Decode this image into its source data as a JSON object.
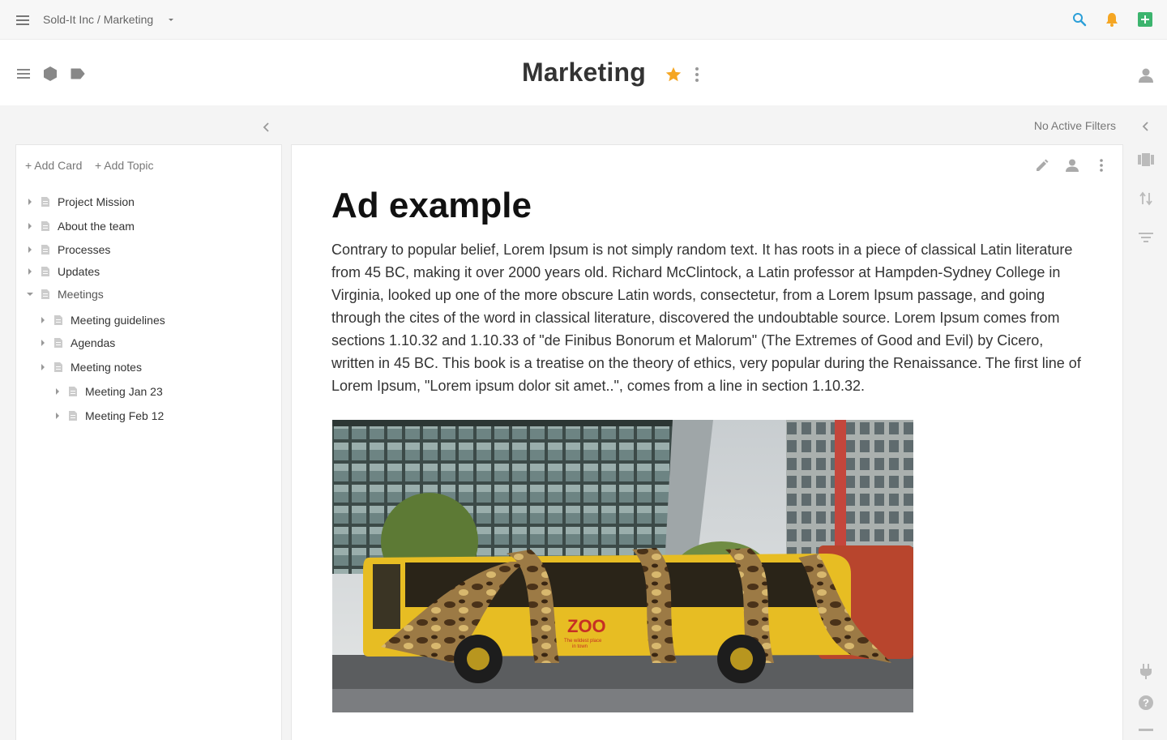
{
  "topbar": {
    "breadcrumb": "Sold-It Inc / Marketing",
    "colors": {
      "search": "#2b9fd8",
      "bell": "#f5a623",
      "add": "#3cb46e"
    },
    "icons": [
      "menu-icon",
      "chevron-down-icon",
      "search-icon",
      "bell-icon",
      "add-square-icon"
    ]
  },
  "header": {
    "title": "Marketing",
    "star_color": "#f5a623",
    "icons": [
      "list-icon",
      "hexagon-icon",
      "tag-icon",
      "star-icon",
      "more-vert-icon",
      "user-icon"
    ]
  },
  "filters": {
    "label": "No Active Filters"
  },
  "sidebar": {
    "add_card": "+ Add Card",
    "add_topic": "+ Add Topic",
    "items": [
      {
        "label": "Project Mission",
        "expanded": false
      },
      {
        "label": "About the team",
        "expanded": false
      },
      {
        "label": "Processes",
        "expanded": false
      },
      {
        "label": "Updates",
        "expanded": false
      },
      {
        "label": "Meetings",
        "expanded": true
      },
      {
        "label": "Meeting guidelines",
        "expanded": false
      },
      {
        "label": "Agendas",
        "expanded": false
      },
      {
        "label": "Meeting notes",
        "expanded": false
      },
      {
        "label": "Meeting Jan 23",
        "expanded": false
      },
      {
        "label": "Meeting Feb 12",
        "expanded": false
      }
    ]
  },
  "card": {
    "title": "Ad example",
    "body": "Contrary to popular belief, Lorem Ipsum is not simply random text. It has roots in a piece of classical Latin literature from 45 BC, making it over 2000 years old. Richard McClintock, a Latin professor at Hampden-Sydney College in Virginia, looked up one of the more obscure Latin words, consectetur, from a Lorem Ipsum passage, and going through the cites of the word in classical literature, discovered the undoubtable source. Lorem Ipsum comes from sections 1.10.32 and 1.10.33 of \"de Finibus Bonorum et Malorum\" (The Extremes of Good and Evil) by Cicero, written in 45 BC. This book is a treatise on the theory of ethics, very popular during the Renaissance. The first line of Lorem Ipsum, \"Lorem ipsum dolor sit amet..\", comes from a line in section 1.10.32.",
    "image": {
      "brand": "ZOO",
      "tagline_1": "The wildest place",
      "tagline_2": "in town"
    },
    "icons": [
      "edit-icon",
      "assign-user-icon",
      "more-vert-icon"
    ]
  },
  "rail": {
    "icons": [
      "view-carousel-icon",
      "sort-icon",
      "filter-icon",
      "plug-icon",
      "help-icon",
      "minus-icon"
    ]
  }
}
